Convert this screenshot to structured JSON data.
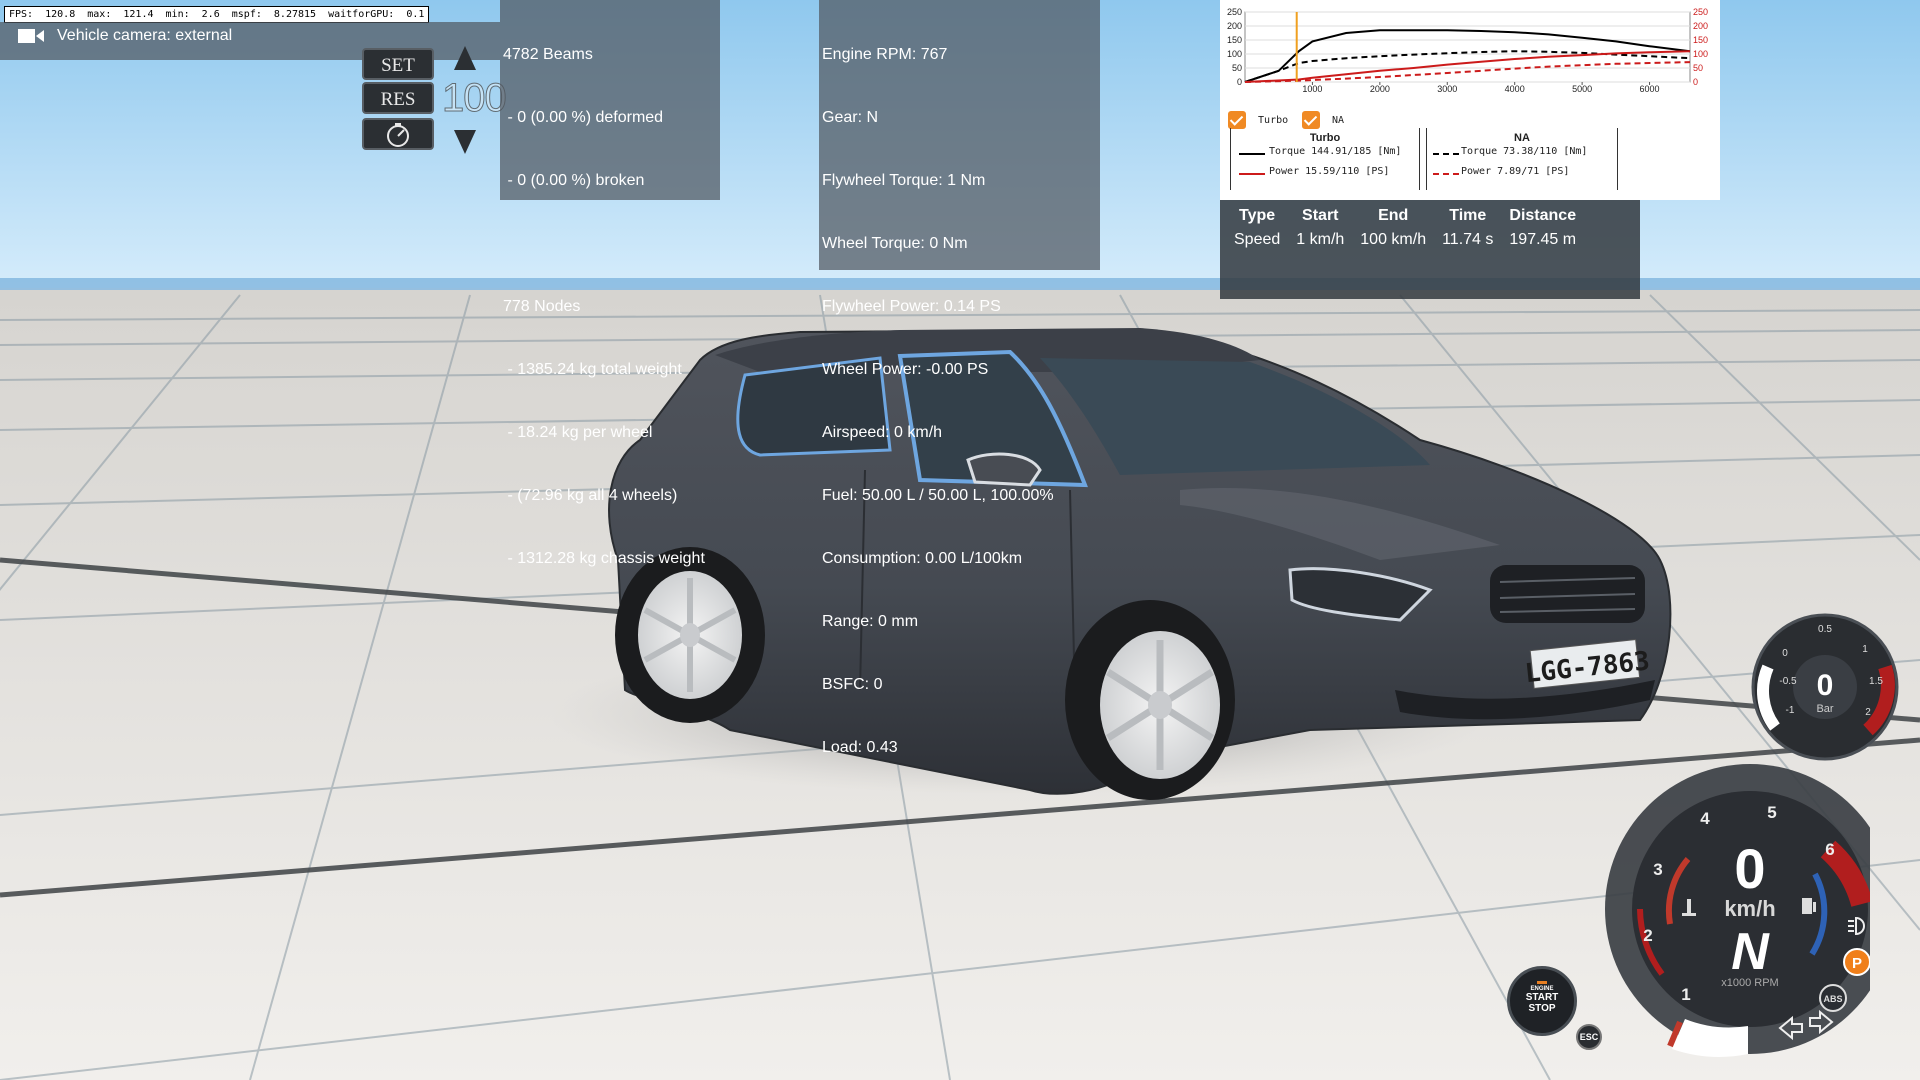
{
  "fps_bar": "FPS:  120.8  max:  121.4  min:  2.6  mspf:  8.27815  waitforGPU:  0.1",
  "camera": {
    "label": "Vehicle camera: external",
    "icon": "video-camera-icon"
  },
  "cruise_control": {
    "set_label": "SET",
    "res_label": "RES",
    "speed": "100"
  },
  "beams_panel": {
    "lines": [
      "4782 Beams",
      " - 0 (0.00 %) deformed",
      " - 0 (0.00 %) broken",
      "",
      "778 Nodes",
      " - 1385.24 kg total weight",
      " - 18.24 kg per wheel",
      " - (72.96 kg all 4 wheels)",
      " - 1312.28 kg chassis weight"
    ]
  },
  "engine_panel": {
    "lines": [
      "Engine RPM: 767",
      "Gear: N",
      "Flywheel Torque: 1 Nm",
      "Wheel Torque: 0 Nm",
      "Flywheel Power: 0.14 PS",
      "Wheel Power: -0.00 PS",
      "Airspeed: 0 km/h",
      "Fuel: 50.00 L / 50.00 L, 100.00%",
      "Consumption: 0.00 L/100km",
      "Range: 0 mm",
      "BSFC: 0",
      "Load: 0.43"
    ]
  },
  "torque_graph": {
    "turbo_checkbox": "Turbo",
    "na_checkbox": "NA",
    "turbo_title": "Turbo",
    "na_title": "NA",
    "turbo_torque": "Torque 144.91/185 [Nm]",
    "turbo_power": "Power  15.59/110  [PS]",
    "na_torque": "Torque 73.38/110 [Nm]",
    "na_power": "Power  7.89/71   [PS]",
    "colors": {
      "torque": "#000000",
      "power": "#cc1b1b",
      "cursor": "#f0a020"
    }
  },
  "chart_data": {
    "type": "line",
    "x_ticks": [
      "1000",
      "2000",
      "3000",
      "4000",
      "5000",
      "6000"
    ],
    "y_ticks_left": [
      "250",
      "200",
      "150",
      "100",
      "50",
      "0"
    ],
    "y_ticks_right": [
      "250",
      "200",
      "150",
      "100",
      "50",
      "0"
    ],
    "xlim": [
      0,
      6600
    ],
    "ylim": [
      0,
      250
    ],
    "cursor_rpm": 767,
    "series": [
      {
        "name": "Turbo Torque",
        "color": "#000000",
        "dash": false,
        "x": [
          0,
          500,
          800,
          1000,
          1500,
          2000,
          2500,
          3000,
          3500,
          4000,
          4500,
          5000,
          5500,
          6000,
          6600
        ],
        "y": [
          0,
          40,
          110,
          145,
          175,
          185,
          185,
          185,
          182,
          178,
          170,
          158,
          145,
          128,
          110
        ]
      },
      {
        "name": "NA Torque",
        "color": "#000000",
        "dash": true,
        "x": [
          0,
          500,
          800,
          1000,
          1500,
          2000,
          2500,
          3000,
          3500,
          4000,
          4500,
          5000,
          5500,
          6000,
          6600
        ],
        "y": [
          0,
          40,
          68,
          75,
          85,
          92,
          98,
          103,
          107,
          110,
          108,
          104,
          98,
          92,
          85
        ]
      },
      {
        "name": "Turbo Power",
        "color": "#cc1b1b",
        "dash": false,
        "x": [
          0,
          800,
          1000,
          1500,
          2000,
          2500,
          3000,
          3500,
          4000,
          4500,
          5000,
          5500,
          6000,
          6600
        ],
        "y": [
          0,
          9,
          15,
          28,
          40,
          50,
          62,
          72,
          82,
          90,
          96,
          102,
          106,
          110
        ]
      },
      {
        "name": "NA Power",
        "color": "#cc1b1b",
        "dash": true,
        "x": [
          0,
          800,
          1000,
          1500,
          2000,
          2500,
          3000,
          3500,
          4000,
          4500,
          5000,
          5500,
          6000,
          6600
        ],
        "y": [
          0,
          5,
          7,
          12,
          18,
          25,
          32,
          40,
          48,
          55,
          60,
          65,
          68,
          71
        ]
      }
    ]
  },
  "accel_table": {
    "headers": [
      "Type",
      "Start",
      "End",
      "Time",
      "Distance"
    ],
    "row": [
      "Speed",
      "1 km/h",
      "100 km/h",
      "11.74 s",
      "197.45 m"
    ]
  },
  "turbo_gauge": {
    "value": "0",
    "unit": "Bar",
    "ticks": [
      "-1",
      "-0.5",
      "0",
      "0.5",
      "1",
      "1.5",
      "2"
    ]
  },
  "speedometer": {
    "speed": "0",
    "speed_unit": "km/h",
    "gear": "N",
    "rpm_unit": "x1000 RPM",
    "rpm_ticks": [
      "1",
      "2",
      "3",
      "4",
      "5",
      "6"
    ],
    "parking_label": "P",
    "abs_label": "ABS",
    "esc_label": "ESC",
    "start_stop": {
      "line1": "ENGINE",
      "line2": "START",
      "line3": "STOP"
    }
  },
  "license_plate": "LGG-7863"
}
